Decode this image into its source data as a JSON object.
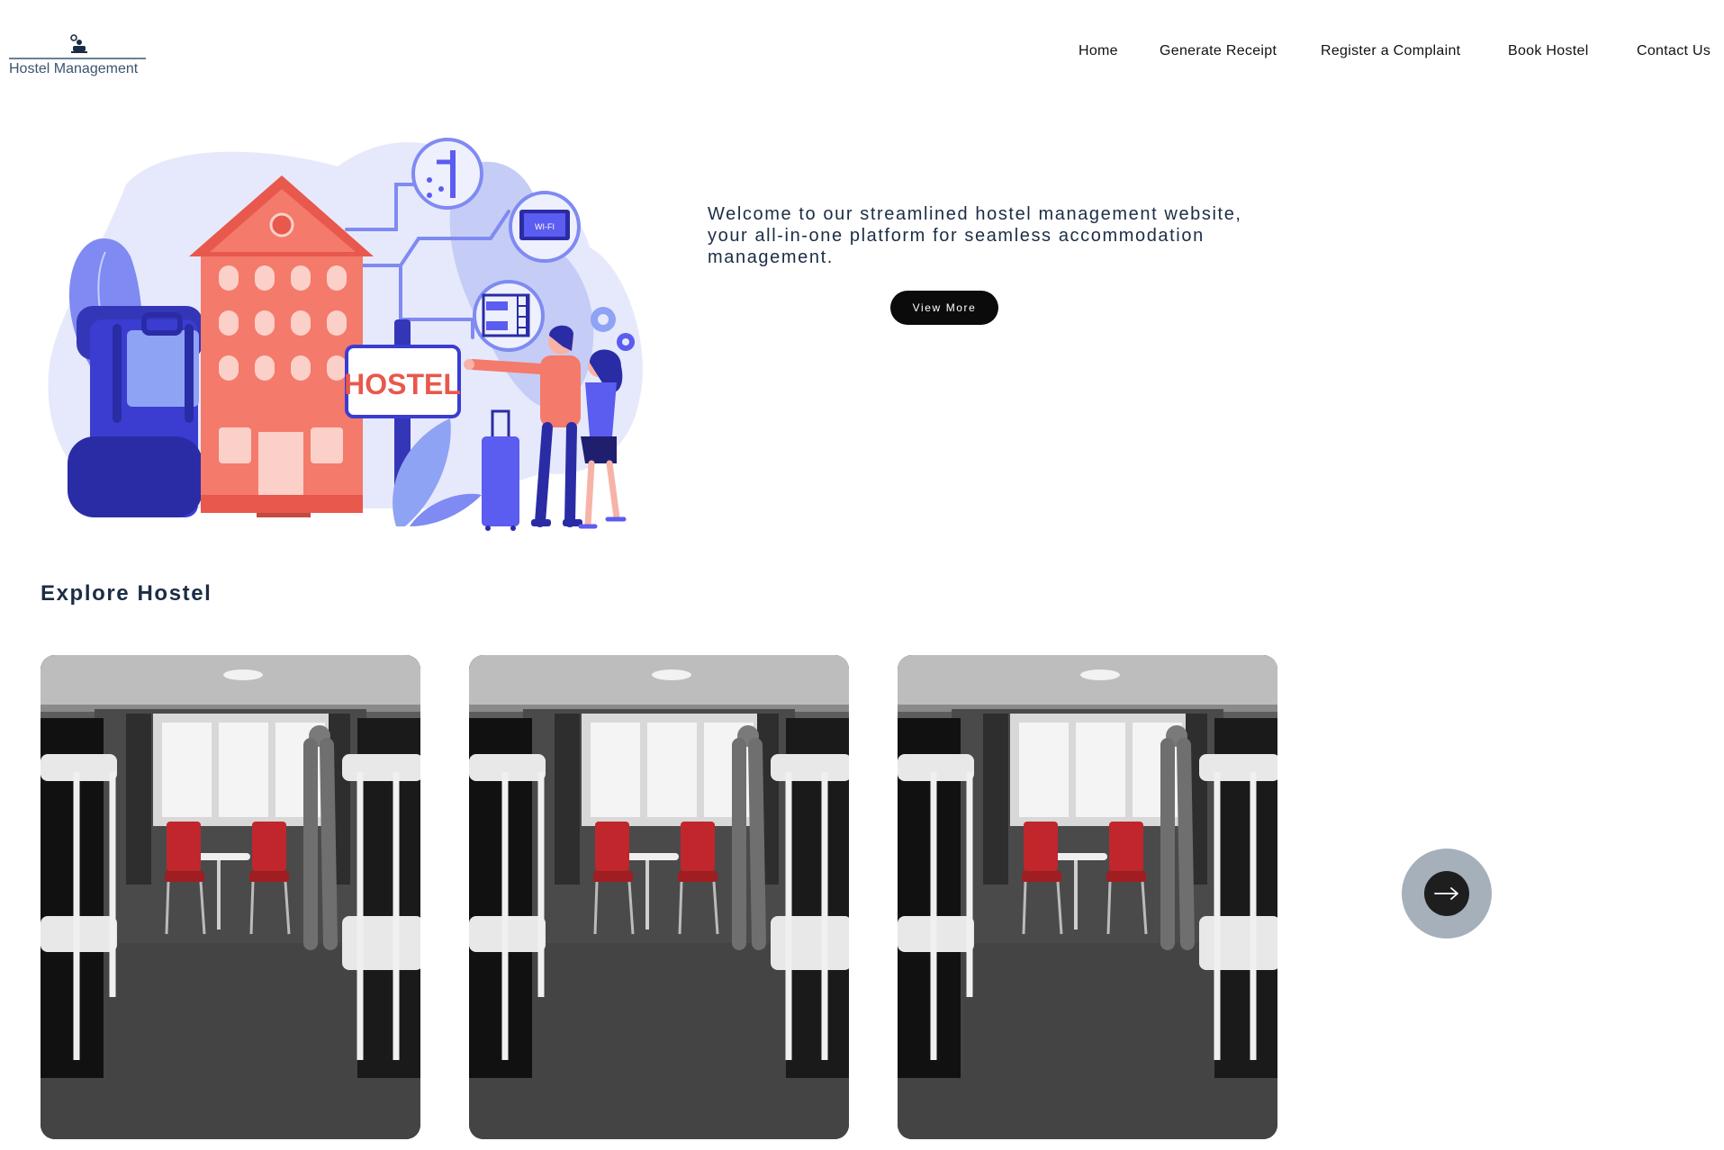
{
  "brand": {
    "name": "Hostel Management",
    "logo_icon": "person-with-bed-icon"
  },
  "nav": {
    "items": [
      {
        "label": "Home"
      },
      {
        "label": "Generate Receipt"
      },
      {
        "label": "Register a Complaint"
      },
      {
        "label": "Book Hostel"
      },
      {
        "label": "Contact Us"
      }
    ]
  },
  "hero": {
    "text": "Welcome to our streamlined hostel management website, your all-in-one platform for seamless accommodation management.",
    "button_label": "View More",
    "illustration": {
      "sign_text": "HOSTEL",
      "wifi_text": "WI-FI"
    }
  },
  "explore": {
    "title": "Explore Hostel",
    "cards": [
      {
        "image": "hostel-room-photo"
      },
      {
        "image": "hostel-room-photo"
      },
      {
        "image": "hostel-room-photo"
      }
    ],
    "next_icon": "arrow-right-icon"
  },
  "colors": {
    "text_dark": "#1b2d45",
    "button_bg": "#0b0b0b",
    "building": "#f47a6b",
    "accent_blue": "#5b5cf0",
    "next_outer": "#a5b0ba"
  }
}
